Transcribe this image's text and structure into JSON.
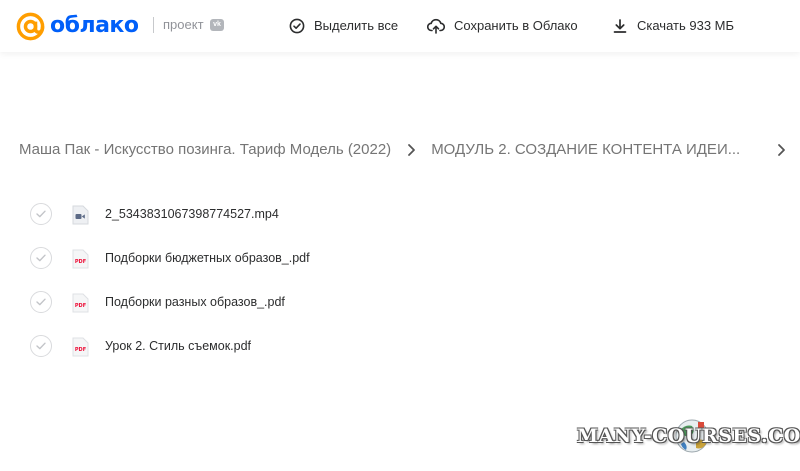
{
  "header": {
    "logo_text": "облако",
    "project_label": "проект",
    "vk_badge": "vk",
    "select_all_label": "Выделить все",
    "save_label": "Сохранить в Облако",
    "download_label": "Скачать 933 МБ"
  },
  "breadcrumb": {
    "items": [
      "Маша Пак - Искусство позинга. Тариф Модель (2022)",
      "МОДУЛЬ 2. СОЗДАНИЕ КОНТЕНТА ИДЕИ..."
    ]
  },
  "files": [
    {
      "name": "2_5343831067398774527.mp4",
      "type": "video"
    },
    {
      "name": "Подборки бюджетных образов_.pdf",
      "type": "pdf"
    },
    {
      "name": "Подборки разных образов_.pdf",
      "type": "pdf"
    },
    {
      "name": "Урок 2. Стиль съемок.pdf",
      "type": "pdf"
    }
  ],
  "icons": {
    "pdf_label": "PDF"
  },
  "watermark": "MANY-COURSES.COM",
  "colors": {
    "brand": "#005ff9",
    "logo_at": "#ff9e00",
    "pdf_red": "#ed0a34",
    "video_blue": "#5c6a86"
  }
}
